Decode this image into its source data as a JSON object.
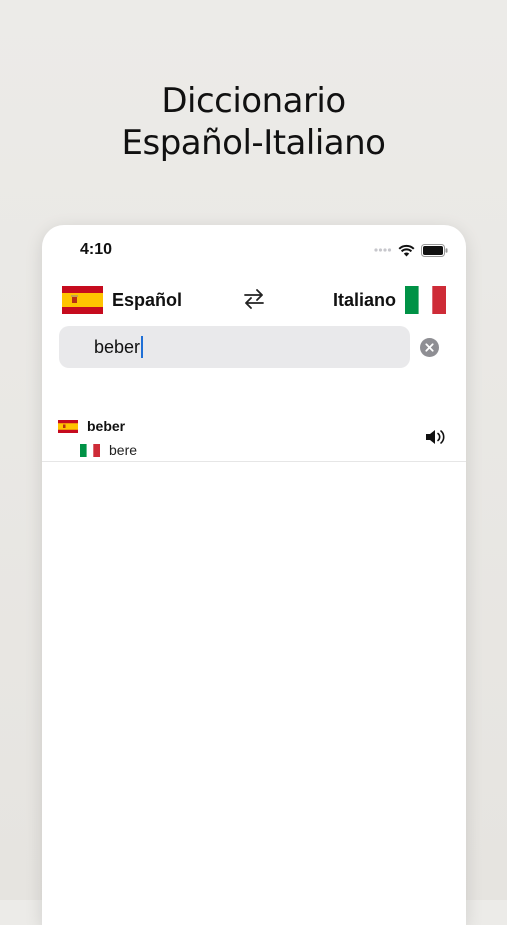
{
  "headline": {
    "line1": "Diccionario",
    "line2": "Español-Italiano"
  },
  "status_bar": {
    "time": "4:10",
    "icons": [
      "signal-icon",
      "wifi-icon",
      "battery-icon"
    ]
  },
  "languages": {
    "source": {
      "label": "Español",
      "flag": "spain-flag-icon"
    },
    "target": {
      "label": "Italiano",
      "flag": "italy-flag-icon"
    },
    "swap_icon": "swap-arrows-icon"
  },
  "search": {
    "value": "beber",
    "clear_icon": "clear-x-icon"
  },
  "results": [
    {
      "source_word": "beber",
      "target_word": "bere",
      "speaker_icon": "speaker-icon"
    }
  ],
  "colors": {
    "background": "#ebeae7",
    "card": "#ffffff",
    "search_bg": "#e9e9eb",
    "caret": "#1f6fd6"
  }
}
